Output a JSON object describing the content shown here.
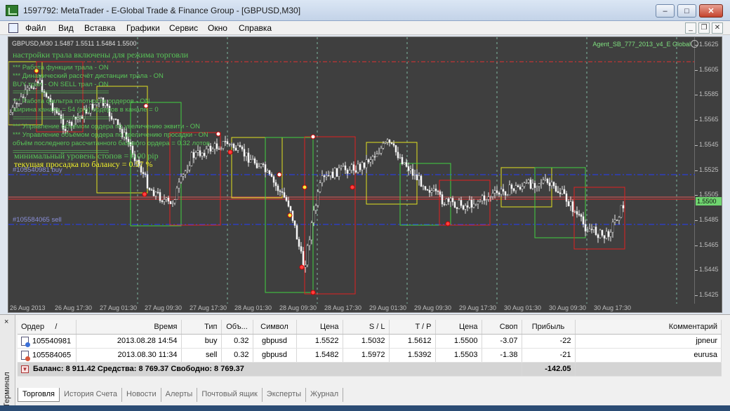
{
  "window": {
    "title": "1597792: MetaTrader - E-Global Trade & Finance Group - [GBPUSD,M30]",
    "controls": {
      "minimize": "–",
      "maximize": "□",
      "close": "✕"
    }
  },
  "menu": {
    "items": [
      "Файл",
      "Вид",
      "Вставка",
      "Графики",
      "Сервис",
      "Окно",
      "Справка"
    ],
    "mdi": {
      "minimize": "_",
      "restore": "❐",
      "close": "✕"
    }
  },
  "chart": {
    "header": "GBPUSD,M30  1.5487 1.5511 1.5484 1.5500",
    "ea_name": "Agent_SB_777_2013_v4_E Global",
    "overlay": {
      "line1": "настройки трала включены для режима  торговли",
      "lines_small": [
        "*** Работа функции трала -   ON",
        "*** Динамический рассчёт дистанции трала -   ON",
        "BUY трал -   ON   SELL трал -   ON",
        "==============================",
        "*** Работа фильтра плотности ордеров -   ON",
        "ширина канала = 54 (pip) ордеров в канале =  0",
        "==============================",
        "*** Управление объёмом ордера по увеличению эквити -   ON",
        "*** Управление объёмом ордера по увеличению просадки -   ON",
        "объём последнего рассчитанного базового ордера =   0.32 лотов",
        "=============================="
      ],
      "min_stops": "минимальный уровень стопов = 0.00 pip",
      "drawdown": "текущая просадка по балансу = 0.57 %",
      "buy_label": "#105540981 buy",
      "sell_label": "#105584065 sell"
    },
    "price_axis": [
      "1.5625",
      "1.5605",
      "1.5585",
      "1.5565",
      "1.5545",
      "1.5525",
      "1.5505",
      "1.5485",
      "1.5465",
      "1.5445",
      "1.5425"
    ],
    "current_price": "1.5500",
    "time_axis": [
      "26 Aug 2013",
      "26 Aug 17:30",
      "27 Aug 01:30",
      "27 Aug 09:30",
      "27 Aug 17:30",
      "28 Aug 01:30",
      "28 Aug 09:30",
      "28 Aug 17:30",
      "29 Aug 01:30",
      "29 Aug 09:30",
      "29 Aug 17:30",
      "30 Aug 01:30",
      "30 Aug 09:30",
      "30 Aug 17:30"
    ],
    "colors": {
      "background": "#3f3f3f",
      "bull_candle": "#000000",
      "bear_candle": "#ffffff",
      "buy_line": "#2b3fd8",
      "sell_line": "#2b3fd8",
      "price_line": "#e03030",
      "box_yellow": "#e0e020",
      "box_green": "#40d040",
      "box_red": "#e02020",
      "overlay_yellow": "#f2f22a",
      "overlay_green": "#58c458"
    }
  },
  "terminal": {
    "vertical_title": "Терминал",
    "close": "×",
    "columns": [
      "Ордер",
      "/",
      "Время",
      "Тип",
      "Объ...",
      "Символ",
      "Цена",
      "S / L",
      "T / P",
      "Цена",
      "Своп",
      "Прибыль",
      "Комментарий"
    ],
    "orders": [
      {
        "order": "105540981",
        "time": "2013.08.28 14:54",
        "type": "buy",
        "volume": "0.32",
        "symbol": "gbpusd",
        "price": "1.5522",
        "sl": "1.5032",
        "tp": "1.5612",
        "cur_price": "1.5500",
        "swap": "-3.07",
        "profit": "-22",
        "comment": "jpneur"
      },
      {
        "order": "105584065",
        "time": "2013.08.30 11:34",
        "type": "sell",
        "volume": "0.32",
        "symbol": "gbpusd",
        "price": "1.5482",
        "sl": "1.5972",
        "tp": "1.5392",
        "cur_price": "1.5503",
        "swap": "-1.38",
        "profit": "-21",
        "comment": "eurusa"
      }
    ],
    "balance": {
      "text": "Баланс: 8 911.42  Средства: 8 769.37  Свободно: 8 769.37",
      "total_profit": "-142.05"
    },
    "tabs": [
      "Торговля",
      "История Счета",
      "Новости",
      "Алерты",
      "Почтовый ящик",
      "Эксперты",
      "Журнал"
    ]
  }
}
